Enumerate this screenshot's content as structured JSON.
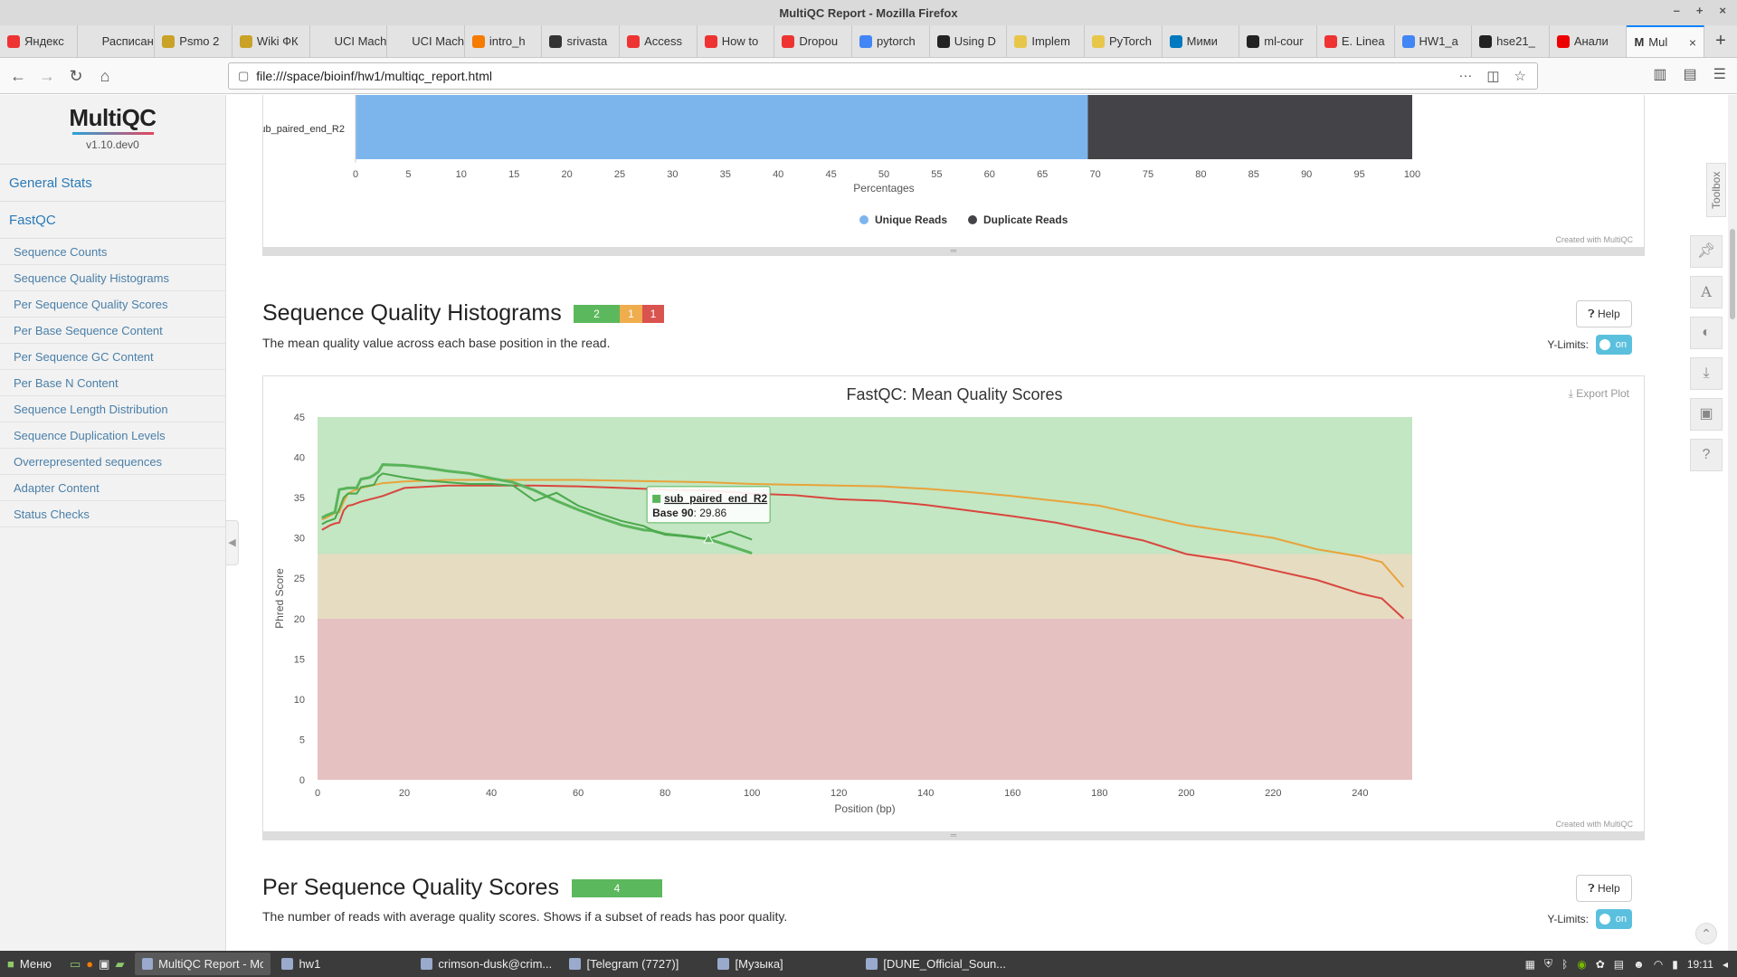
{
  "window": {
    "title": "MultiQC Report - Mozilla Firefox"
  },
  "tabs": [
    {
      "label": "Яндекс",
      "color": "#e33"
    },
    {
      "label": "Расписани",
      "color": ""
    },
    {
      "label": "Psmo 2",
      "color": "#c9a227"
    },
    {
      "label": "Wiki ФК",
      "color": "#c9a227"
    },
    {
      "label": "UCI Machin",
      "color": ""
    },
    {
      "label": "UCI Machin",
      "color": ""
    },
    {
      "label": "intro_h",
      "color": "#f57c00"
    },
    {
      "label": "srivasta",
      "color": "#333"
    },
    {
      "label": "Access",
      "color": "#e33"
    },
    {
      "label": "How to",
      "color": "#e33"
    },
    {
      "label": "Dropou",
      "color": "#e33"
    },
    {
      "label": "pytorch",
      "color": "#4285f4"
    },
    {
      "label": "Using D",
      "color": "#222"
    },
    {
      "label": "Implem",
      "color": "#e8c64a"
    },
    {
      "label": "PyTorch",
      "color": "#e8c64a"
    },
    {
      "label": "Мими",
      "color": "#0079bf"
    },
    {
      "label": "ml-cour",
      "color": "#222"
    },
    {
      "label": "E. Linea",
      "color": "#e33"
    },
    {
      "label": "HW1_a",
      "color": "#4285f4"
    },
    {
      "label": "hse21_",
      "color": "#222"
    },
    {
      "label": "Анали",
      "color": "#e00"
    }
  ],
  "active_tab": {
    "label": "Mul",
    "icon": "M"
  },
  "url": "file:///space/bioinf/hw1/multiqc_report.html",
  "sidebar": {
    "logo": "MultiQC",
    "version": "v1.10.dev0",
    "general": "General Stats",
    "fastqc": "FastQC",
    "items": [
      "Sequence Counts",
      "Sequence Quality Histograms",
      "Per Sequence Quality Scores",
      "Per Base Sequence Content",
      "Per Sequence GC Content",
      "Per Base N Content",
      "Sequence Length Distribution",
      "Sequence Duplication Levels",
      "Overrepresented sequences",
      "Adapter Content",
      "Status Checks"
    ]
  },
  "dup_chart": {
    "sample": "sub_paired_end_R2",
    "unique_pct": 69.3,
    "xticks": [
      "0",
      "5",
      "10",
      "15",
      "20",
      "25",
      "30",
      "35",
      "40",
      "45",
      "50",
      "55",
      "60",
      "65",
      "70",
      "75",
      "80",
      "85",
      "90",
      "95",
      "100"
    ],
    "xlabel": "Percentages",
    "legend": [
      "Unique Reads",
      "Duplicate Reads"
    ],
    "colors": {
      "unique": "#7cb5ec",
      "duplicate": "#434348"
    },
    "credit": "Created with MultiQC"
  },
  "sqh": {
    "title": "Sequence Quality Histograms",
    "status": [
      "2",
      "1",
      "1"
    ],
    "desc": "The mean quality value across each base position in the read.",
    "help": "Help",
    "ylimits": "Y-Limits:",
    "toggle": "on",
    "chart_title": "FastQC: Mean Quality Scores",
    "export": "Export Plot",
    "tooltip_name": "sub_paired_end_R2",
    "tooltip_label": "Base 90",
    "tooltip_value": "29.86",
    "credit": "Created with MultiQC"
  },
  "psqs": {
    "title": "Per Sequence Quality Scores",
    "status": "4",
    "desc": "The number of reads with average quality scores. Shows if a subset of reads has poor quality.",
    "help": "Help",
    "ylimits": "Y-Limits:",
    "toggle": "on"
  },
  "toolbox_label": "Toolbox",
  "chart_data": {
    "type": "line",
    "title": "FastQC: Mean Quality Scores",
    "xlabel": "Position (bp)",
    "ylabel": "Phred Score",
    "xlim": [
      0,
      252
    ],
    "ylim": [
      0,
      45
    ],
    "xticks": [
      0,
      20,
      40,
      60,
      80,
      100,
      120,
      140,
      160,
      180,
      200,
      220,
      240
    ],
    "yticks": [
      0,
      5,
      10,
      15,
      20,
      25,
      30,
      35,
      40,
      45
    ],
    "bands": [
      {
        "from": 0,
        "to": 20,
        "color": "#e6c1c1"
      },
      {
        "from": 20,
        "to": 28,
        "color": "#e6dcc1"
      },
      {
        "from": 28,
        "to": 45,
        "color": "#c3e6c3"
      }
    ],
    "series": [
      {
        "color": "#e8a33a",
        "x": [
          1,
          2,
          3,
          4,
          5,
          6,
          7,
          8,
          9,
          10,
          15,
          20,
          30,
          40,
          50,
          60,
          70,
          80,
          90,
          100,
          110,
          120,
          130,
          140,
          150,
          160,
          170,
          180,
          190,
          200,
          210,
          220,
          230,
          240,
          245,
          250
        ],
        "y": [
          32.3,
          32.5,
          32.8,
          33.1,
          33.2,
          34.5,
          35.5,
          35.8,
          36.0,
          36.2,
          36.8,
          37.0,
          37.2,
          37.2,
          37.2,
          37.2,
          37.1,
          37.0,
          36.9,
          36.7,
          36.6,
          36.5,
          36.4,
          36.1,
          35.7,
          35.2,
          34.6,
          34.0,
          32.8,
          31.6,
          30.8,
          30.0,
          28.6,
          27.7,
          27.0,
          23.9
        ]
      },
      {
        "color": "#d9463e",
        "x": [
          1,
          2,
          3,
          4,
          5,
          6,
          7,
          8,
          9,
          10,
          15,
          20,
          30,
          40,
          50,
          60,
          70,
          80,
          90,
          100,
          110,
          120,
          130,
          140,
          150,
          160,
          170,
          180,
          190,
          200,
          210,
          220,
          230,
          240,
          245,
          250
        ],
        "y": [
          31.0,
          31.3,
          31.6,
          31.8,
          31.9,
          33.4,
          34.0,
          34.1,
          34.3,
          34.5,
          35.2,
          36.2,
          36.5,
          36.5,
          36.5,
          36.4,
          36.2,
          36.0,
          35.9,
          35.5,
          35.3,
          34.8,
          34.6,
          34.1,
          33.4,
          32.7,
          31.9,
          30.8,
          29.7,
          28.0,
          27.2,
          26.0,
          24.8,
          23.1,
          22.5,
          20.0
        ]
      },
      {
        "color": "#5ab45a",
        "x": [
          1,
          2,
          3,
          4,
          5,
          6,
          7,
          8,
          9,
          10,
          11,
          12,
          13,
          14,
          15,
          20,
          25,
          30,
          35,
          40,
          45,
          50,
          55,
          60,
          65,
          70,
          75,
          77,
          80,
          85,
          90,
          95,
          100
        ],
        "y": [
          32.5,
          32.8,
          33.0,
          33.2,
          36.0,
          36.1,
          36.2,
          36.2,
          36.2,
          37.3,
          37.4,
          37.5,
          37.8,
          38.2,
          39.1,
          39.0,
          38.7,
          38.3,
          38.0,
          37.4,
          36.9,
          35.9,
          34.6,
          33.5,
          32.5,
          31.6,
          31.0,
          30.9,
          30.5,
          30.2,
          29.86,
          29.0,
          28.1
        ]
      },
      {
        "color": "#4aa84a",
        "x": [
          1,
          2,
          3,
          4,
          5,
          6,
          7,
          8,
          9,
          10,
          11,
          12,
          13,
          14,
          15,
          20,
          25,
          30,
          35,
          40,
          45,
          50,
          55,
          60,
          65,
          70,
          75,
          77,
          80,
          85,
          90,
          95,
          100
        ],
        "y": [
          31.7,
          32.0,
          32.2,
          32.4,
          33.6,
          35.0,
          35.5,
          35.5,
          35.5,
          36.3,
          36.4,
          36.5,
          36.6,
          37.6,
          38.0,
          37.5,
          37.1,
          36.9,
          36.7,
          36.7,
          36.5,
          34.6,
          35.6,
          34.0,
          33.0,
          32.1,
          31.5,
          31.0,
          30.4,
          30.2,
          29.9,
          30.8,
          29.8
        ]
      }
    ]
  },
  "taskbar": {
    "menu": "Меню",
    "tasks": [
      "MultiQC Report - Mo...",
      "hw1",
      "crimson-dusk@crim...",
      "[Telegram (7727)]",
      "[Музыка]",
      "[DUNE_Official_Soun..."
    ],
    "clock": "19:11"
  }
}
